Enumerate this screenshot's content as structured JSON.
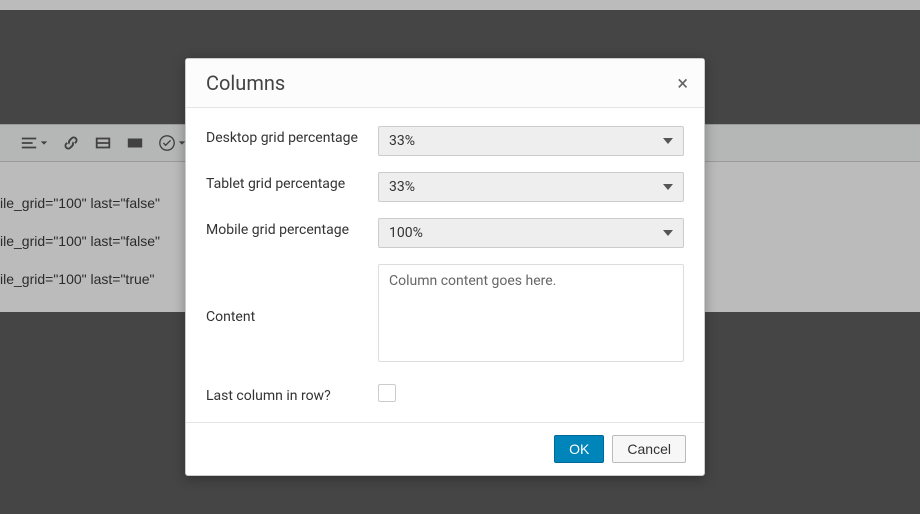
{
  "editor": {
    "lines": [
      "ile_grid=\"100\" last=\"false\"",
      "ile_grid=\"100\" last=\"false\"",
      "ile_grid=\"100\" last=\"true\""
    ]
  },
  "dialog": {
    "title": "Columns",
    "fields": {
      "desktop_label": "Desktop grid percentage",
      "desktop_value": "33%",
      "tablet_label": "Tablet grid percentage",
      "tablet_value": "33%",
      "mobile_label": "Mobile grid percentage",
      "mobile_value": "100%",
      "content_label": "Content",
      "content_value": "Column content goes here.",
      "last_label": "Last column in row?"
    },
    "buttons": {
      "ok": "OK",
      "cancel": "Cancel"
    }
  }
}
